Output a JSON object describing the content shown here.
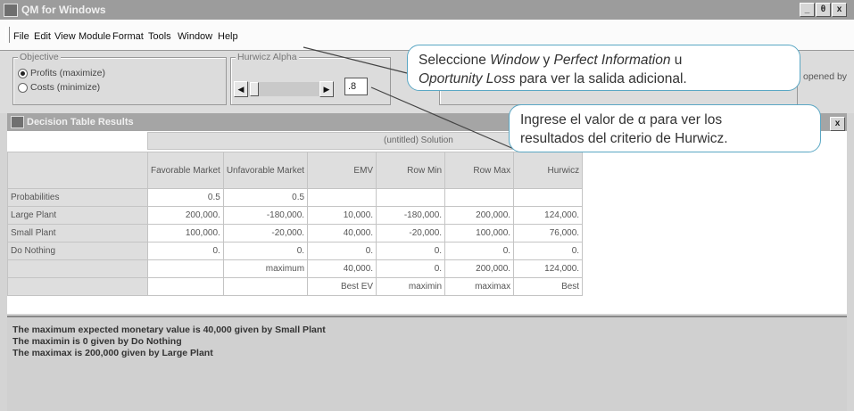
{
  "window": {
    "title": "QM for Windows",
    "controls": [
      "_",
      "θ",
      "x"
    ]
  },
  "menu": [
    "File",
    "Edit",
    "View",
    "Module",
    "Format",
    "Tools",
    "Window",
    "Help"
  ],
  "objective": {
    "label": "Objective",
    "options": [
      {
        "label": "Profits (maximize)",
        "selected": true
      },
      {
        "label": "Costs (minimize)",
        "selected": false
      }
    ]
  },
  "hurwicz": {
    "label": "Hurwicz Alpha",
    "value": ".8"
  },
  "partial_right_text": "opened by",
  "child_window": {
    "title": "Decision Table Results",
    "close_glyph": "x"
  },
  "table": {
    "caption": "(untitled) Solution",
    "columns": [
      "",
      "Favorable Market",
      "Unfavorable Market",
      "EMV",
      "Row Min",
      "Row Max",
      "Hurwicz"
    ],
    "rows": [
      [
        "Probabilities",
        "0.5",
        "0.5",
        "",
        "",
        "",
        ""
      ],
      [
        "Large Plant",
        "200,000.",
        "-180,000.",
        "10,000.",
        "-180,000.",
        "200,000.",
        "124,000."
      ],
      [
        "Small Plant",
        "100,000.",
        "-20,000.",
        "40,000.",
        "-20,000.",
        "100,000.",
        "76,000."
      ],
      [
        "Do Nothing",
        "0.",
        "0.",
        "0.",
        "0.",
        "0.",
        "0."
      ],
      [
        "",
        "",
        "maximum",
        "40,000.",
        "0.",
        "200,000.",
        "124,000."
      ],
      [
        "",
        "",
        "",
        "Best EV",
        "maximin",
        "maximax",
        "Best"
      ]
    ]
  },
  "output_lines": [
    "The maximum expected monetary value is  40,000 given by Small Plant",
    "The maximin is  0 given by Do Nothing",
    "The maximax is  200,000 given by Large Plant"
  ],
  "callouts": {
    "first": {
      "t1": "Seleccione ",
      "i1": "Window",
      "t2": " y ",
      "i2": "Perfect Information",
      "t3": " u",
      "i3": "Oportunity Loss",
      "t4": " para ver la salida adicional."
    },
    "second": {
      "line1": "Ingrese el valor de α para ver los",
      "line2": "resultados del criterio de Hurwicz."
    }
  },
  "colors": {
    "callout_border": "#5aa7c4",
    "window_title": "#9c9c9c"
  }
}
